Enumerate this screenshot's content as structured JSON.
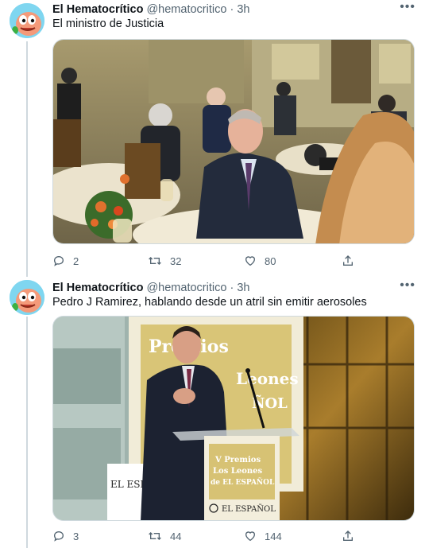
{
  "tweets": [
    {
      "author": "El Hematocrítico",
      "handle": "@hematocritico",
      "separator": "·",
      "time": "3h",
      "text": "El ministro de Justicia",
      "replies": "2",
      "retweets": "32",
      "likes": "80",
      "image_icon": "photo-minister-at-event"
    },
    {
      "author": "El Hematocrítico",
      "handle": "@hematocritico",
      "separator": "·",
      "time": "3h",
      "text": "Pedro J Ramirez, hablando desde un atril sin emitir aerosoles",
      "replies": "3",
      "retweets": "44",
      "likes": "144",
      "image_icon": "photo-speaker-at-podium",
      "banner": {
        "line1": "Premios",
        "line2": "Leones",
        "line3": "ÑOL",
        "podium_line1": "V Premios",
        "podium_line2": "Los Leones",
        "podium_line3": "de EL ESPAÑOL",
        "podium_logo": "EL ESPAÑOL",
        "left_sign": "EL ESPAÑOL"
      }
    }
  ],
  "colors": {
    "text": "#0f1419",
    "secondary": "#536471",
    "border": "#cfd9de",
    "avatar_bg": "#7fd6f0"
  }
}
